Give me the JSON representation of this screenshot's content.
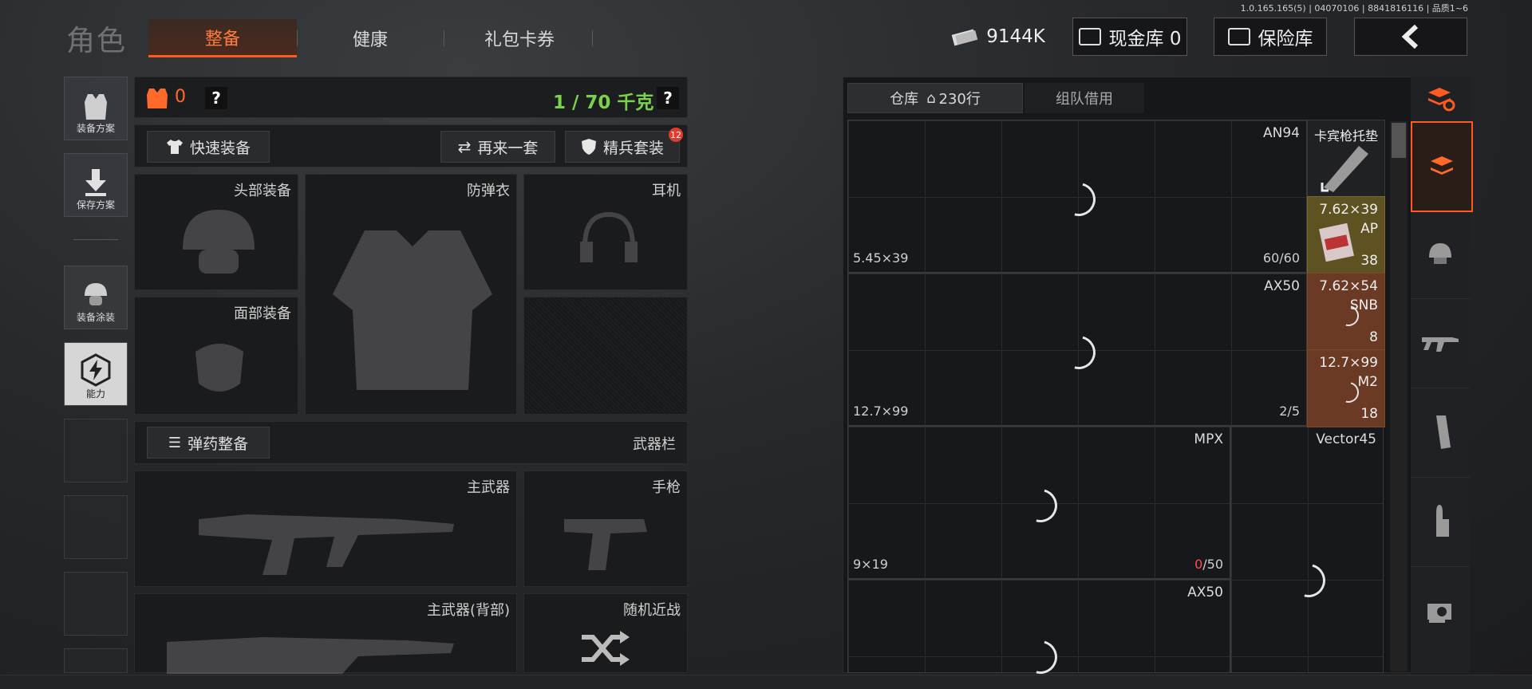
{
  "version": "1.0.165.165(5) | 04070106 | 8841816116 | 品质1~6",
  "header": {
    "title": "角色",
    "tabs": [
      {
        "label": "整备",
        "active": true
      },
      {
        "label": "健康",
        "active": false
      },
      {
        "label": "礼包卡券",
        "active": false
      }
    ],
    "currency": "9144K",
    "cash_vault": "现金库 0",
    "safe_box": "保险库",
    "back_icon": "chevron-left-icon"
  },
  "sidebar": {
    "items": [
      {
        "label": "装备方案",
        "icon": "vest-icon"
      },
      {
        "label": "保存方案",
        "icon": "download-icon"
      },
      {
        "label": "装备涂装",
        "icon": "helmet-paint-icon"
      },
      {
        "label": "能力",
        "icon": "ability-icon"
      }
    ]
  },
  "equip": {
    "armor_count": "0",
    "help": "?",
    "weight": "1 / 70 千克",
    "quick_equip": "快速装备",
    "again": "再来一套",
    "elite": "精兵套装",
    "elite_badge": "12",
    "slots": {
      "head": "头部装备",
      "vest": "防弹衣",
      "headset": "耳机",
      "face": "面部装备",
      "primary": "主武器",
      "pistol": "手枪",
      "primary_back": "主武器(背部)",
      "melee": "随机近战"
    },
    "ammo_btn": "弹药整备",
    "weapon_bar": "武器栏"
  },
  "warehouse": {
    "tab_storage": "仓库",
    "rows": "230行",
    "tab_team": "组队借用",
    "items": [
      {
        "name": "AN94",
        "caliber": "5.45×39",
        "count": "60/60"
      },
      {
        "name": "AX50",
        "caliber": "12.7×99",
        "count": "2/5"
      },
      {
        "name": "MPX",
        "caliber": "9×19",
        "count_zero": "0",
        "count_rest": "/50"
      },
      {
        "name": "Vector45"
      },
      {
        "name": "AX50"
      }
    ],
    "small": [
      {
        "name": "卡宾枪托垫"
      },
      {
        "line1": "7.62×39",
        "line2": "AP",
        "count": "38",
        "color": "#6b5a26"
      },
      {
        "line1": "7.62×54",
        "line2": "SNB",
        "count": "8",
        "color": "#6e3b26"
      },
      {
        "line1": "12.7×99",
        "line2": "M2",
        "count": "18",
        "color": "#6e3b26"
      }
    ]
  },
  "colors": {
    "accent": "#ff5a1f",
    "weight_green": "#7bd24a",
    "zero_red": "#ff4d4d"
  }
}
